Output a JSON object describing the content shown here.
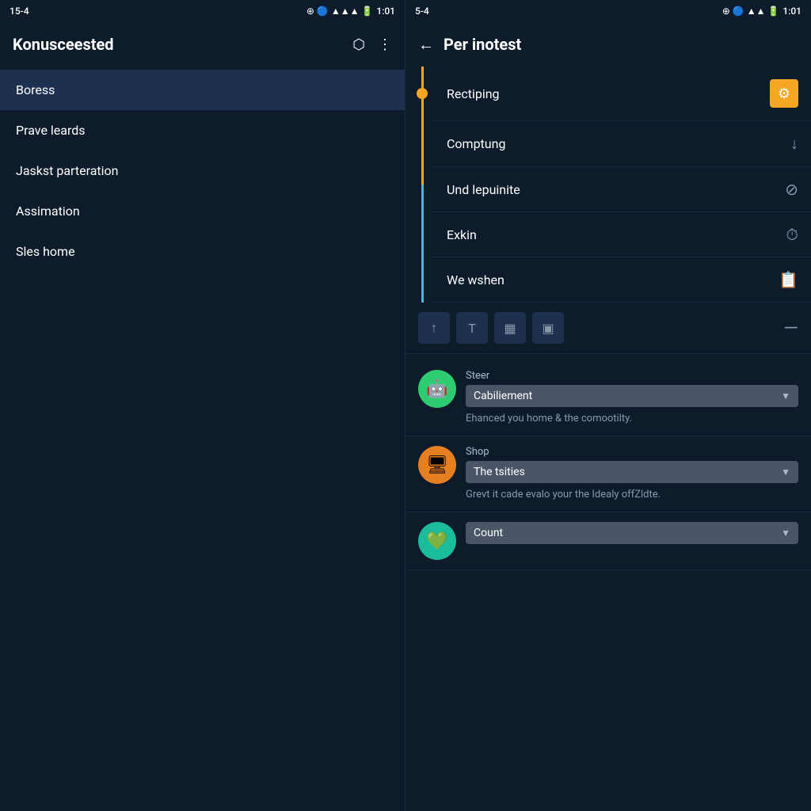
{
  "left": {
    "statusBar": {
      "left": "15-4",
      "time": "1:01"
    },
    "header": {
      "title": "Konusceested",
      "boxIcon": "📦",
      "moreIcon": "⋮"
    },
    "navItems": [
      {
        "label": "Boress",
        "active": true
      },
      {
        "label": "Prave leards",
        "active": false
      },
      {
        "label": "Jaskst parteration",
        "active": false
      },
      {
        "label": "Assimation",
        "active": false
      },
      {
        "label": "Sles home",
        "active": false
      }
    ]
  },
  "right": {
    "statusBar": {
      "left": "5-4",
      "time": "1:01"
    },
    "header": {
      "backLabel": "←",
      "title": "Per inotest"
    },
    "menuItems": [
      {
        "label": "Rectiping",
        "iconType": "gear",
        "activeOrange": true
      },
      {
        "label": "Comptung",
        "iconType": "download"
      },
      {
        "label": "Und lepuinite",
        "iconType": "block-circle"
      },
      {
        "label": "Exkin",
        "iconType": "clock"
      },
      {
        "label": "We wshen",
        "iconType": "clipboard"
      }
    ],
    "toolbar": {
      "buttons": [
        "↑",
        "T",
        "▦",
        "▣"
      ],
      "minus": "—"
    },
    "appItems": [
      {
        "iconColor": "green",
        "iconEmoji": "🤖",
        "appLabel": "Steer",
        "dropdownValue": "Cabiliement",
        "description": "Ehanced you home & the comootilty."
      },
      {
        "iconColor": "orange",
        "iconEmoji": "🖥",
        "appLabel": "Shop",
        "dropdownValue": "The tsities",
        "description": "Grevt it cade evalo your the Idealy offZldte."
      },
      {
        "iconColor": "teal",
        "iconEmoji": "💚",
        "appLabel": "",
        "dropdownValue": "Count",
        "description": ""
      }
    ]
  }
}
